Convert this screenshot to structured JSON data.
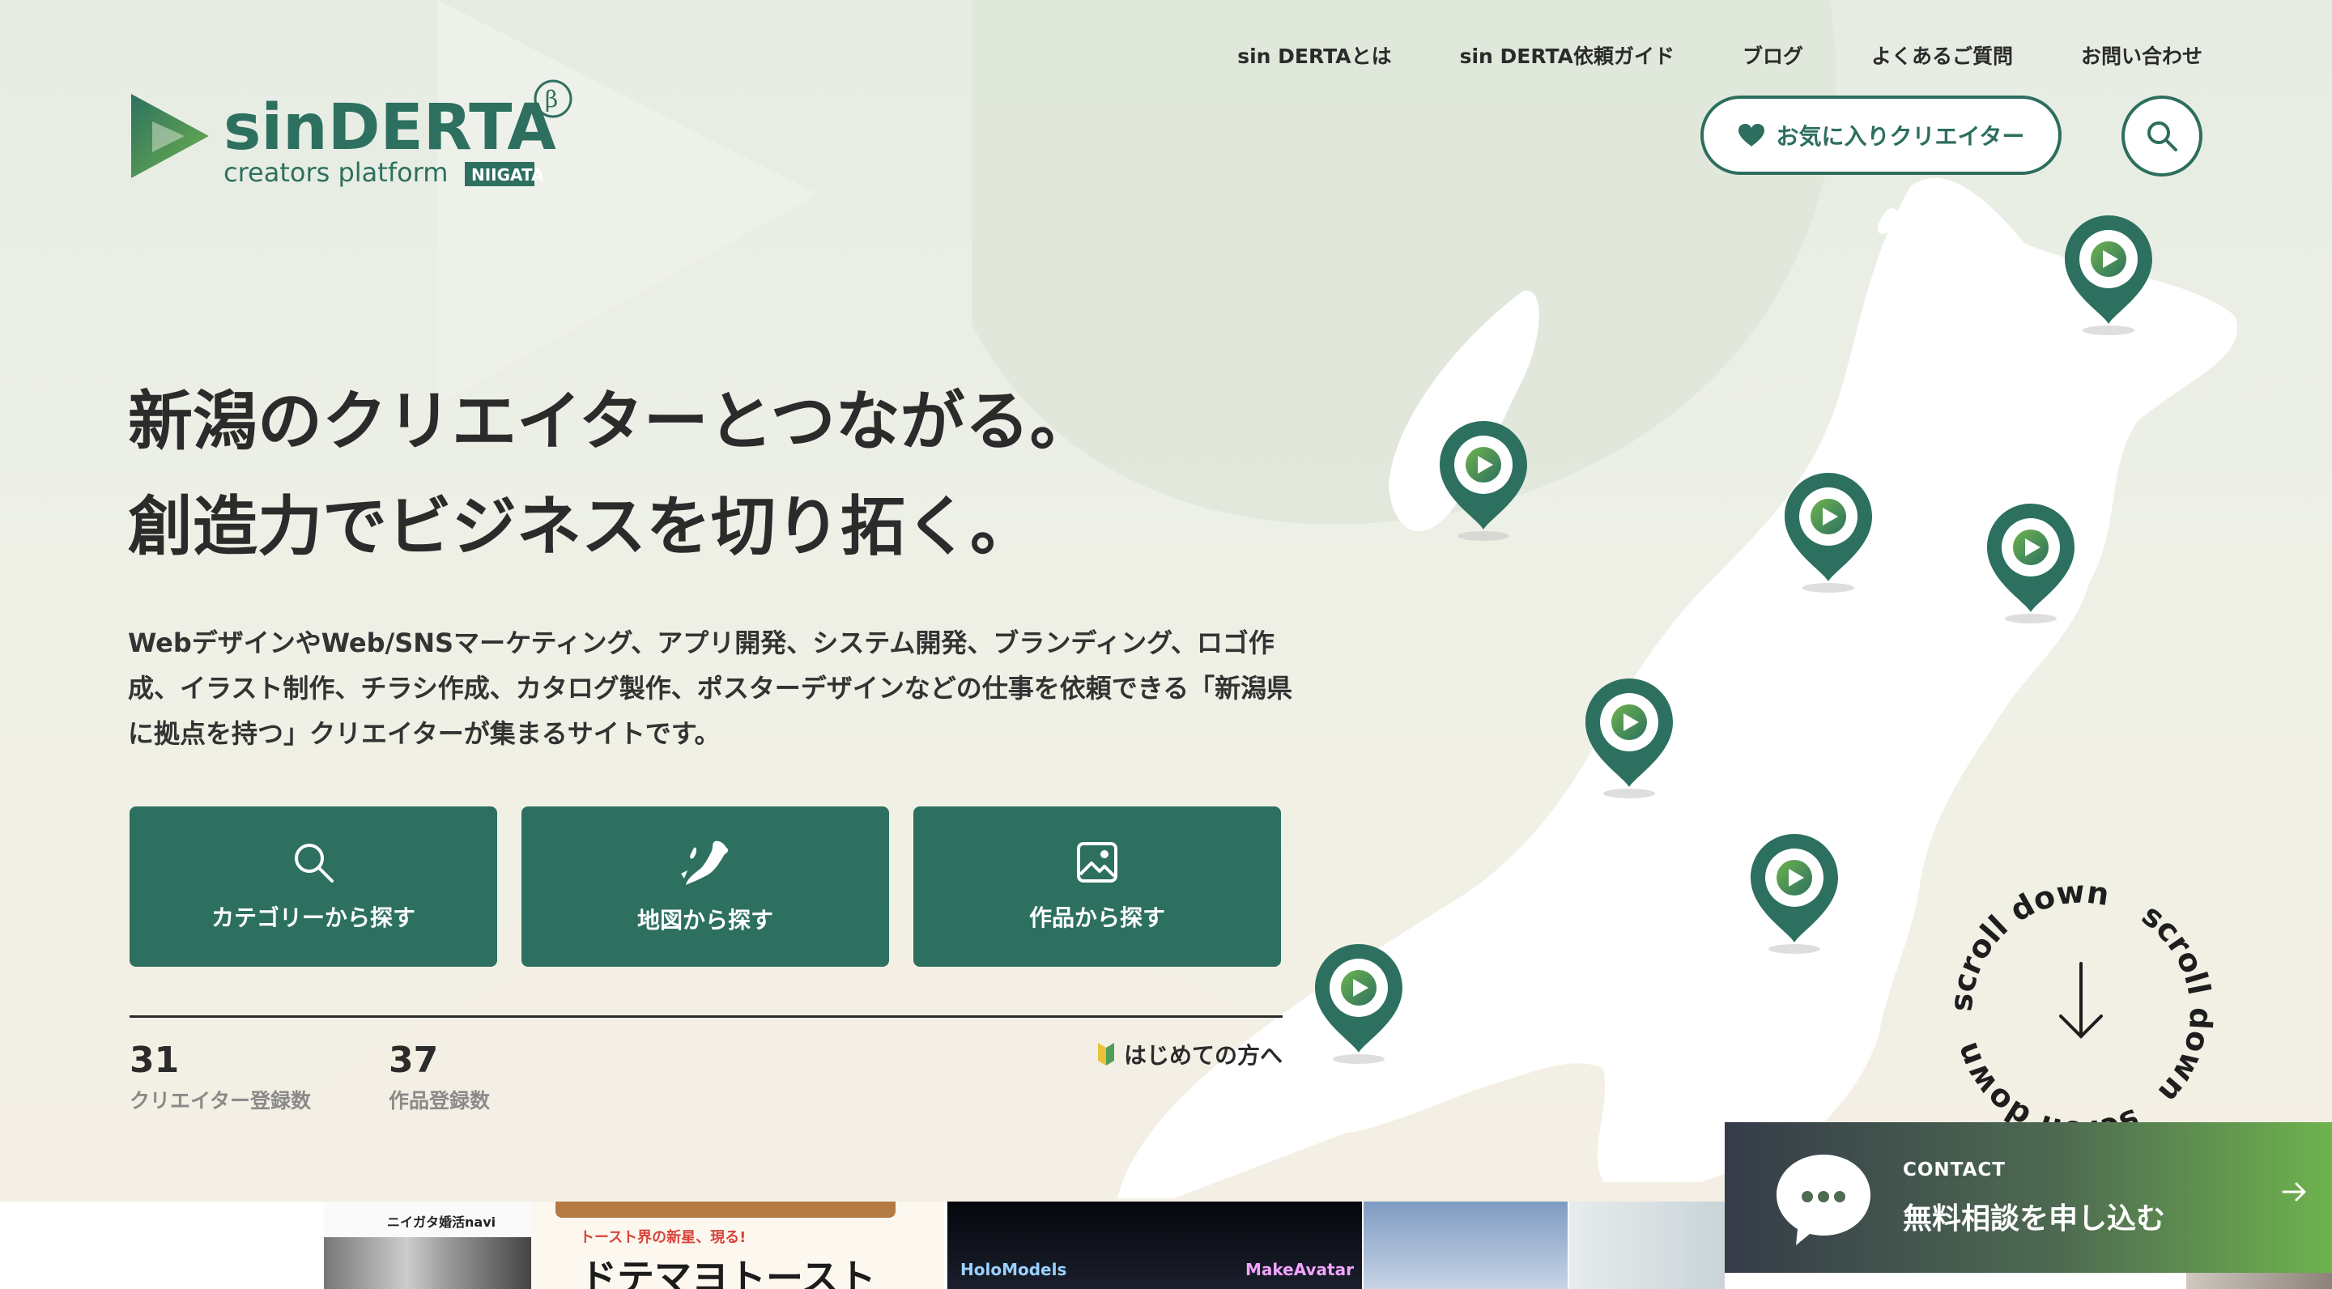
{
  "logo": {
    "name": "sinDERTA",
    "beta": "β",
    "tagline": "creators platform",
    "region": "NIIGATA"
  },
  "nav": {
    "items": [
      "sin DERTAとは",
      "sin DERTA依頼ガイド",
      "ブログ",
      "よくあるご質問",
      "お問い合わせ"
    ]
  },
  "favorites_label": "お気に入りクリエイター",
  "hero": {
    "title_line1": "新潟のクリエイターとつながる。",
    "title_line2": "創造力でビジネスを切り拓く。",
    "description": "WebデザインやWeb/SNSマーケティング、アプリ開発、システム開発、ブランディング、ロゴ作成、イラスト制作、チラシ作成、カタログ製作、ポスターデザインなどの仕事を依頼できる「新潟県に拠点を持つ」クリエイターが集まるサイトです。"
  },
  "search_buttons": [
    {
      "label": "カテゴリーから探す",
      "icon": "search-icon"
    },
    {
      "label": "地図から探す",
      "icon": "niigata-map-icon"
    },
    {
      "label": "作品から探す",
      "icon": "image-icon"
    }
  ],
  "stats": [
    {
      "value": "31",
      "label": "クリエイター登録数"
    },
    {
      "value": "37",
      "label": "作品登録数"
    }
  ],
  "beginner_label": "はじめての方へ",
  "scroll_text": "scroll down",
  "contact": {
    "small": "CONTACT",
    "big": "無料相談を申し込む"
  },
  "gallery": {
    "thumb1": "ニイガタ婚活navi",
    "thumb2_sub": "トースト界の新星、現る!",
    "thumb2_main": "ドテマヨトースト",
    "thumb4_left": "HoloModels",
    "thumb4_right": "MakeAvatar"
  },
  "colors": {
    "brand": "#2d7060",
    "brand_light": "#6eb34e",
    "text": "#2b2b2b"
  }
}
